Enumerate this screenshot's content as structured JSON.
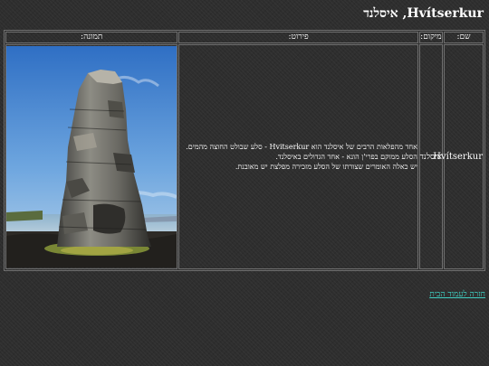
{
  "page": {
    "title": "Hvítserkur, איסלנד"
  },
  "table": {
    "headers": {
      "name": "שם:",
      "location": "מיקום:",
      "description": "פירוט:",
      "image": "תמונה:"
    },
    "row": {
      "name": "Hvítserkur",
      "location": "איסלנד",
      "description_line1": "אחד מהפלאות הרבים של איסלנד הוא Hvitserkur - סלע שבולט החוצה מהמים.",
      "description_line2": "הסלע ממוקם בפרי'ן הונא - אחד הגדולים באיסלנד.",
      "description_line3": "יש כאלה האומרים שצורתו של הסלע מזכירה מפלצת יש מאובנת."
    }
  },
  "footer": {
    "back_link": "חזרה לעמוד הבית"
  },
  "icons": {
    "photo": "rock-formation-photo"
  }
}
